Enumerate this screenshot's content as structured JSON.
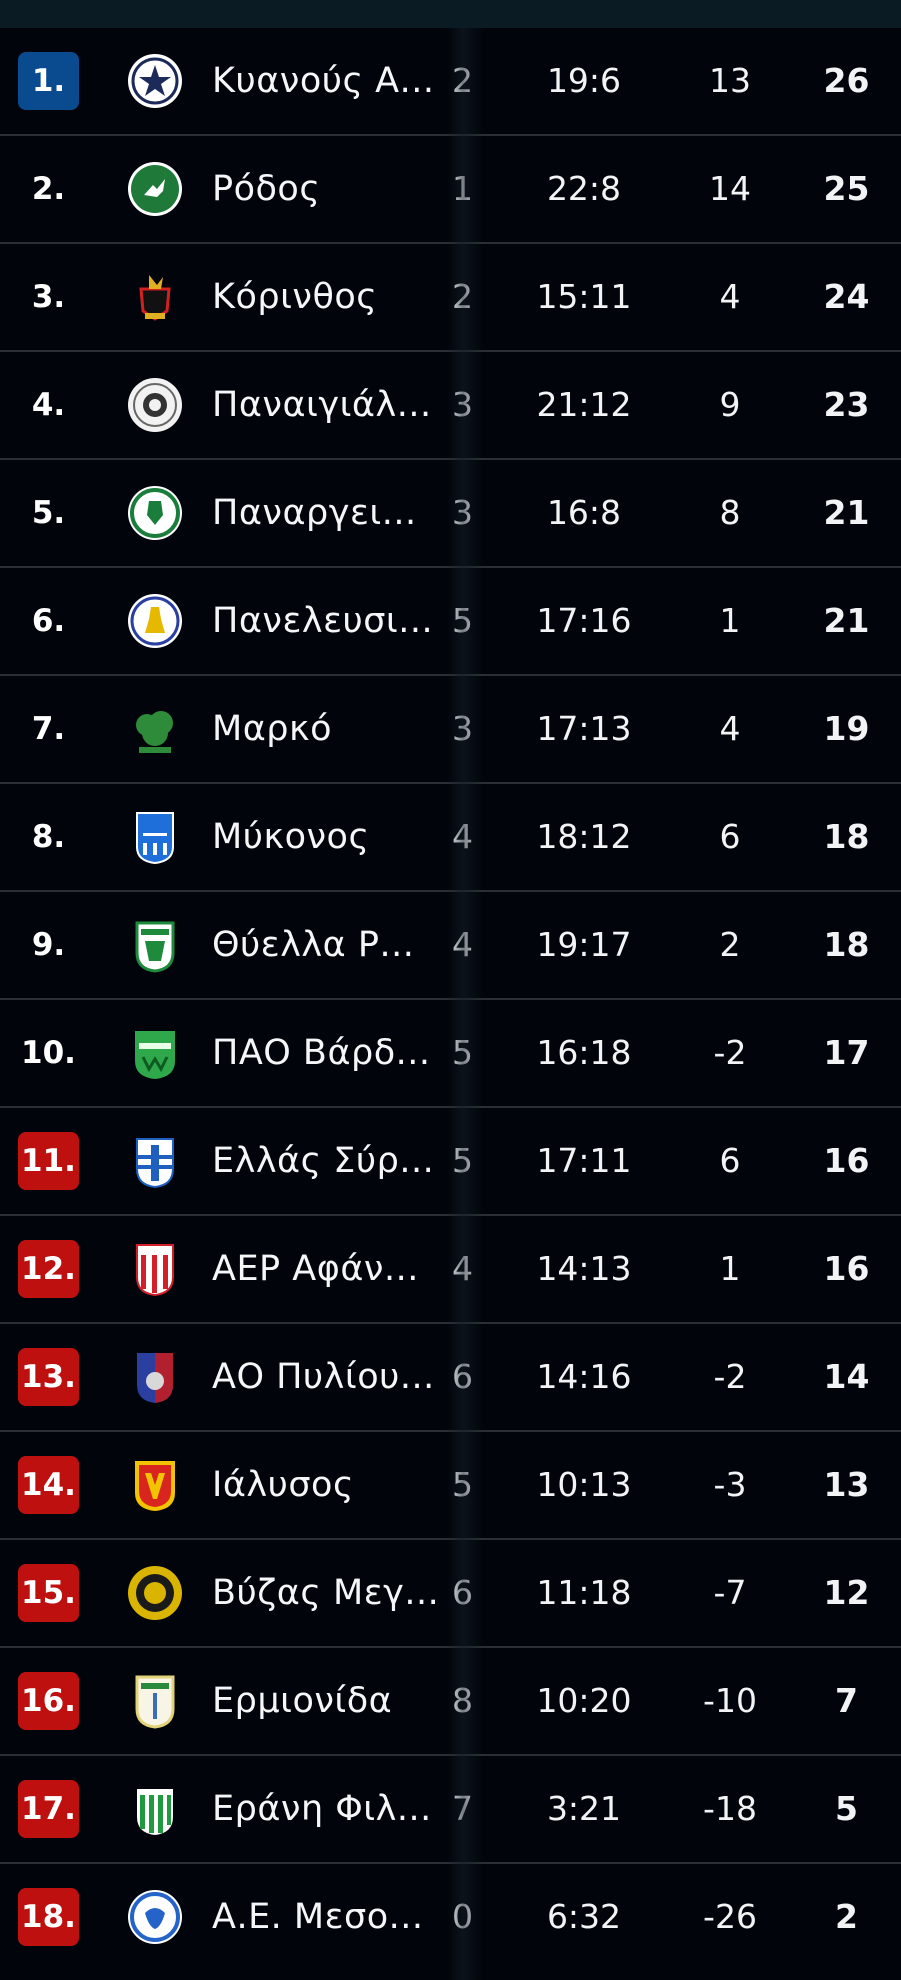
{
  "rows": [
    {
      "rank": "1.",
      "rank_style": "blue",
      "team": "Κυανούς Α...",
      "played": "2",
      "goals": "19:6",
      "diff": "13",
      "points": "26",
      "logo": "kyanous-star-crest-icon",
      "logo_color": "#ffffff"
    },
    {
      "rank": "2.",
      "rank_style": "none",
      "team": "Ρόδος",
      "played": "1",
      "goals": "22:8",
      "diff": "14",
      "points": "25",
      "logo": "rodos-deer-crest-icon",
      "logo_color": "#1f7a3a"
    },
    {
      "rank": "3.",
      "rank_style": "none",
      "team": "Κόρινθος",
      "played": "2",
      "goals": "15:11",
      "diff": "4",
      "points": "24",
      "logo": "korinthos-pegasus-crest-icon",
      "logo_color": "#d32020"
    },
    {
      "rank": "4.",
      "rank_style": "none",
      "team": "Παναιγιάλ...",
      "played": "3",
      "goals": "21:12",
      "diff": "9",
      "points": "23",
      "logo": "panaigialeios-round-crest-icon",
      "logo_color": "#e8e8e8"
    },
    {
      "rank": "5.",
      "rank_style": "none",
      "team": "Παναργει...",
      "played": "3",
      "goals": "16:8",
      "diff": "8",
      "points": "21",
      "logo": "panargeiakos-round-crest-icon",
      "logo_color": "#1a7d3c"
    },
    {
      "rank": "6.",
      "rank_style": "none",
      "team": "Πανελευσι...",
      "played": "5",
      "goals": "17:16",
      "diff": "1",
      "points": "21",
      "logo": "paneleusiniakos-round-crest-icon",
      "logo_color": "#e6b800"
    },
    {
      "rank": "7.",
      "rank_style": "none",
      "team": "Μαρκό",
      "played": "3",
      "goals": "17:13",
      "diff": "4",
      "points": "19",
      "logo": "marko-tree-crest-icon",
      "logo_color": "#2e8b3a"
    },
    {
      "rank": "8.",
      "rank_style": "none",
      "team": "Μύκονος",
      "played": "4",
      "goals": "18:12",
      "diff": "6",
      "points": "18",
      "logo": "mykonos-shield-crest-icon",
      "logo_color": "#1e6fd9"
    },
    {
      "rank": "9.",
      "rank_style": "none",
      "team": "Θύελλα Ρ...",
      "played": "4",
      "goals": "19:17",
      "diff": "2",
      "points": "18",
      "logo": "thyella-shield-crest-icon",
      "logo_color": "#1e8a3c"
    },
    {
      "rank": "10.",
      "rank_style": "none",
      "team": "ΠΑΟ Βάρδ...",
      "played": "5",
      "goals": "16:18",
      "diff": "-2",
      "points": "17",
      "logo": "pao-vardas-shield-crest-icon",
      "logo_color": "#2ea84a"
    },
    {
      "rank": "11.",
      "rank_style": "red",
      "team": "Ελλάς Σύρ...",
      "played": "5",
      "goals": "17:11",
      "diff": "6",
      "points": "16",
      "logo": "ellas-syrou-shield-crest-icon",
      "logo_color": "#1f5fbf"
    },
    {
      "rank": "12.",
      "rank_style": "red",
      "team": "ΑΕΡ Αφάν...",
      "played": "4",
      "goals": "14:13",
      "diff": "1",
      "points": "16",
      "logo": "aer-afantou-shield-crest-icon",
      "logo_color": "#d21f2a"
    },
    {
      "rank": "13.",
      "rank_style": "red",
      "team": "ΑΟ Πυλίου...",
      "played": "6",
      "goals": "14:16",
      "diff": "-2",
      "points": "14",
      "logo": "ao-pyliou-shield-crest-icon",
      "logo_color": "#2a3fa0"
    },
    {
      "rank": "14.",
      "rank_style": "red",
      "team": "Ιάλυσος",
      "played": "5",
      "goals": "10:13",
      "diff": "-3",
      "points": "13",
      "logo": "ialysos-shield-crest-icon",
      "logo_color": "#f2c300"
    },
    {
      "rank": "15.",
      "rank_style": "red",
      "team": "Βύζας Μεγ...",
      "played": "6",
      "goals": "11:18",
      "diff": "-7",
      "points": "12",
      "logo": "vyzas-round-crest-icon",
      "logo_color": "#d9b400"
    },
    {
      "rank": "16.",
      "rank_style": "red",
      "team": "Ερμιονίδα",
      "played": "8",
      "goals": "10:20",
      "diff": "-10",
      "points": "7",
      "logo": "ermionida-shield-crest-icon",
      "logo_color": "#e2d27a"
    },
    {
      "rank": "17.",
      "rank_style": "red",
      "team": "Εράνη Φιλ...",
      "played": "7",
      "goals": "3:21",
      "diff": "-18",
      "points": "5",
      "logo": "erani-shield-crest-icon",
      "logo_color": "#1f9a3e"
    },
    {
      "rank": "18.",
      "rank_style": "red",
      "team": "Α.Ε. Μεσο...",
      "played": "0",
      "goals": "6:32",
      "diff": "-26",
      "points": "2",
      "logo": "ae-mesologgiou-round-crest-icon",
      "logo_color": "#2563c9"
    }
  ]
}
